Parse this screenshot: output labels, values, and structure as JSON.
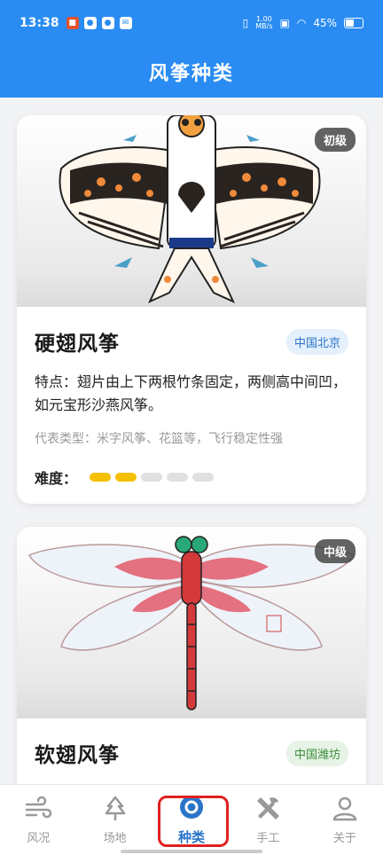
{
  "status": {
    "time": "13:38",
    "speed_top": "1.00",
    "speed_bottom": "MB/s",
    "battery": "45%"
  },
  "header": {
    "title": "风筝种类"
  },
  "cards": [
    {
      "level": "初级",
      "title": "硬翅风筝",
      "location": "中国北京",
      "desc": "特点：翅片由上下两根竹条固定，两侧高中间凹，如元宝形沙燕风筝。",
      "types": "代表类型：米字风筝、花篮等，飞行稳定性强",
      "difficulty_label": "难度：",
      "difficulty": 2,
      "difficulty_max": 5
    },
    {
      "level": "中级",
      "title": "软翅风筝",
      "location": "中国潍坊"
    }
  ],
  "tabs": [
    {
      "label": "风况",
      "icon": "wind-icon"
    },
    {
      "label": "场地",
      "icon": "tree-icon"
    },
    {
      "label": "种类",
      "icon": "kite-category-icon"
    },
    {
      "label": "手工",
      "icon": "tools-icon"
    },
    {
      "label": "关于",
      "icon": "user-icon"
    }
  ],
  "active_tab": 2
}
